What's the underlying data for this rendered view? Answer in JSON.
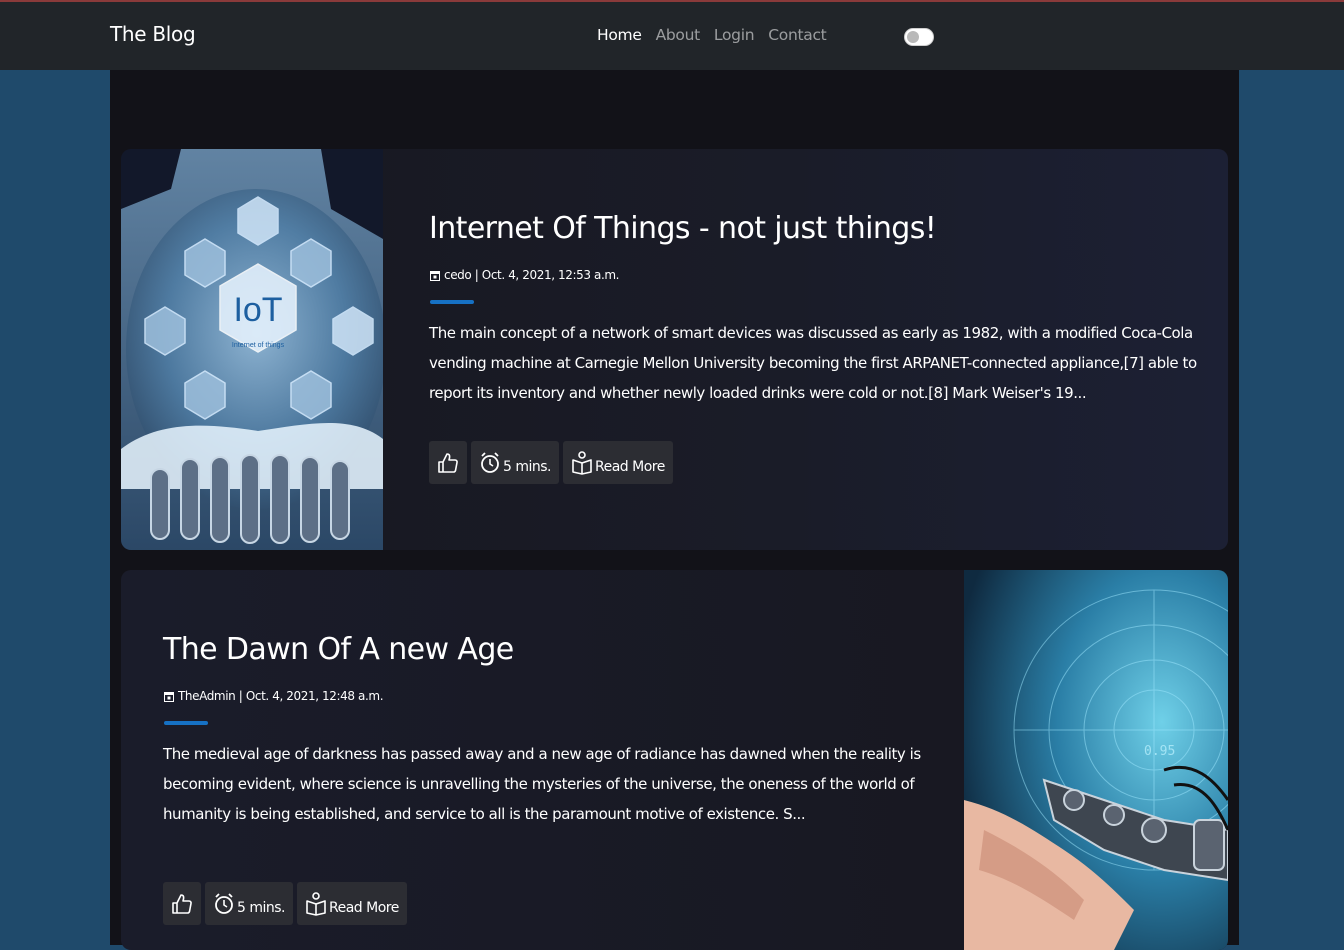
{
  "navbar": {
    "brand": "The Blog",
    "links": [
      {
        "label": "Home",
        "active": true
      },
      {
        "label": "About",
        "active": false
      },
      {
        "label": "Login",
        "active": false
      },
      {
        "label": "Contact",
        "active": false
      }
    ],
    "theme_toggle_on": false
  },
  "posts": [
    {
      "title": "Internet Of Things - not just things!",
      "meta": "cedo | Oct. 4, 2021, 12:53 a.m.",
      "excerpt": "The main concept of a network of smart devices was discussed as early as 1982, with a modified Coca-Cola vending machine at Carnegie Mellon University becoming the first ARPANET-connected appliance,[7] able to report its inventory and whether newly loaded drinks were cold or not.[8] Mark Weiser's 19...",
      "read_time": "5 mins.",
      "read_more": "Read More",
      "image_icon": "iot-hexagon-hands-image",
      "image_text": "IoT",
      "image_subtext": "Internet of things"
    },
    {
      "title": "The Dawn Of A new Age",
      "meta": "TheAdmin | Oct. 4, 2021, 12:48 a.m.",
      "excerpt": "The medieval age of darkness has passed away and a new age of radiance has dawned when the reality is becoming evident, where science is unravelling the mysteries of the universe, the oneness of the world of humanity is being established, and service to all is the paramount motive of existence. S...",
      "read_time": "5 mins.",
      "read_more": "Read More",
      "image_icon": "robot-human-handshake-image"
    }
  ],
  "colors": {
    "navbar_bg": "#212529",
    "page_bg": "#1f4a6b",
    "main_bg": "#121218",
    "accent_rule": "#1671c4",
    "button_bg": "#2c2d33"
  }
}
